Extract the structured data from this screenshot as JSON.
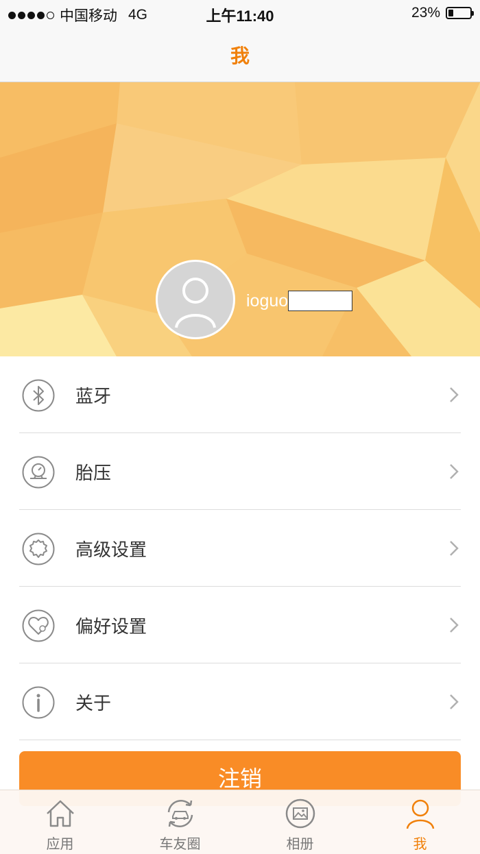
{
  "status_bar": {
    "carrier": "中国移动",
    "network": "4G",
    "time": "上午11:40",
    "battery_text": "23%",
    "battery_level": 0.23,
    "signal_bars_filled": 4,
    "signal_bars_total": 5
  },
  "nav": {
    "title": "我"
  },
  "profile": {
    "username_visible": "ioguo",
    "username_redacted": true,
    "avatar_icon": "user-silhouette-icon"
  },
  "menu": {
    "items": [
      {
        "label": "蓝牙",
        "icon": "bluetooth-icon"
      },
      {
        "label": "胎压",
        "icon": "tire-pressure-icon"
      },
      {
        "label": "高级设置",
        "icon": "advanced-settings-icon"
      },
      {
        "label": "偏好设置",
        "icon": "preferences-icon"
      },
      {
        "label": "关于",
        "icon": "info-icon"
      }
    ]
  },
  "logout": {
    "label": "注销"
  },
  "tabs": [
    {
      "label": "应用",
      "icon": "home-icon",
      "active": false
    },
    {
      "label": "车友圈",
      "icon": "car-circle-icon",
      "active": false
    },
    {
      "label": "相册",
      "icon": "album-icon",
      "active": false
    },
    {
      "label": "我",
      "icon": "person-icon",
      "active": true
    }
  ],
  "colors": {
    "accent": "#f0800a",
    "logout_button": "#f98c26",
    "banner": "#f8c46a",
    "icon_gray": "#8a8a8a"
  }
}
